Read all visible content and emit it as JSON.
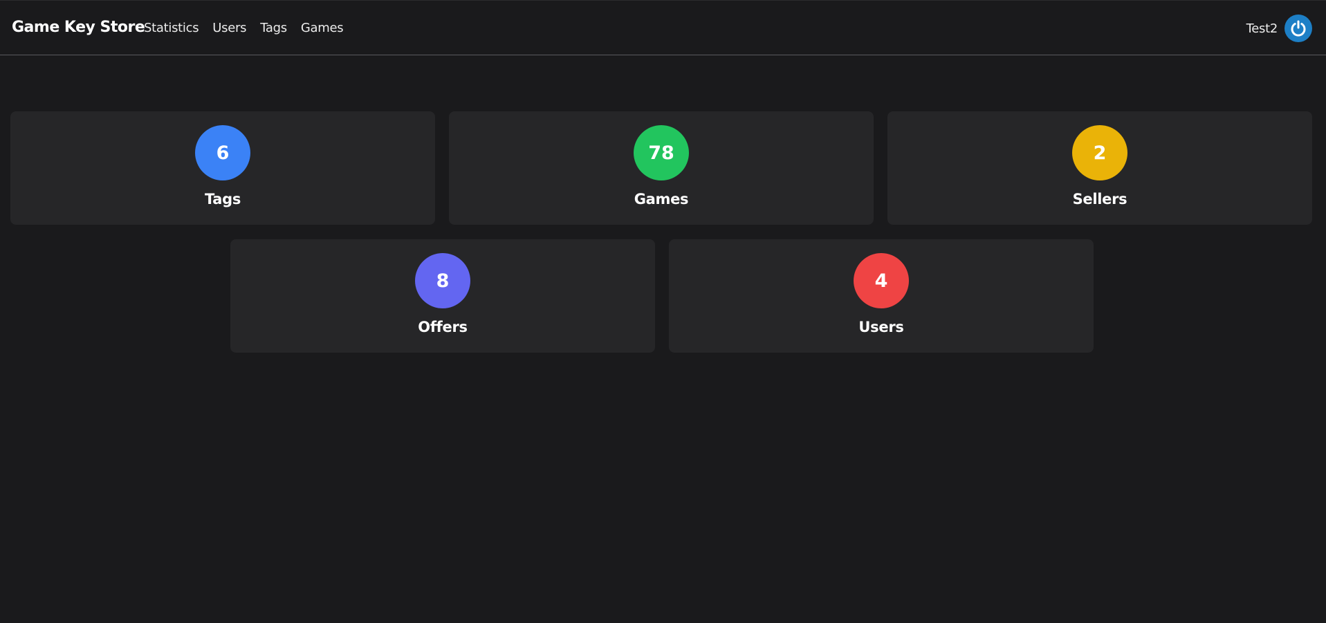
{
  "header": {
    "brand": "Game Key Store",
    "nav": [
      "Statistics",
      "Users",
      "Tags",
      "Games"
    ],
    "username": "Test2",
    "logout_icon": "power-icon",
    "logout_color": "#1d7fc6"
  },
  "stats": [
    {
      "value": "6",
      "label": "Tags",
      "color": "#3b82f6"
    },
    {
      "value": "78",
      "label": "Games",
      "color": "#22c55e"
    },
    {
      "value": "2",
      "label": "Sellers",
      "color": "#eab308"
    },
    {
      "value": "8",
      "label": "Offers",
      "color": "#6366f1"
    },
    {
      "value": "4",
      "label": "Users",
      "color": "#ef4444"
    }
  ]
}
